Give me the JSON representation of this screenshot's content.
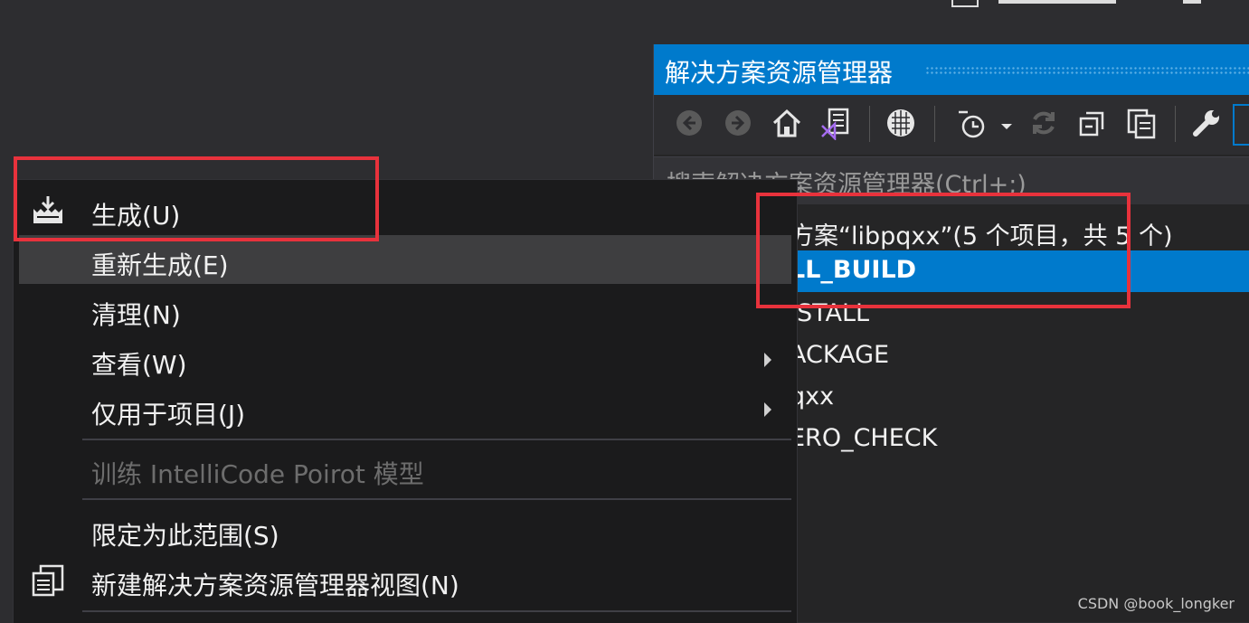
{
  "explorer": {
    "title": "解决方案资源管理器",
    "search_placeholder": "搜索解决方案资源管理器(Ctrl+;)",
    "tree": {
      "solution": "方案“libpqxx”(5 个项目，共 5 个)",
      "items": [
        "LL_BUILD",
        "ISTALL",
        "ACKAGE",
        "qxx",
        "ERO_CHECK"
      ]
    },
    "toolbar_icons": [
      "back-icon",
      "forward-icon",
      "home-icon",
      "vs-solution-icon",
      "filter-icon",
      "history-icon",
      "sync-icon",
      "collapse-all-icon",
      "copy-icon",
      "wrench-icon"
    ]
  },
  "context_menu": {
    "items": [
      {
        "label": "生成(U)",
        "icon": "build-icon"
      },
      {
        "label": "重新生成(E)"
      },
      {
        "label": "清理(N)"
      },
      {
        "label": "查看(W)",
        "submenu": true
      },
      {
        "label": "仅用于项目(J)",
        "submenu": true
      },
      {
        "label": "训练 IntelliCode Poirot 模型",
        "disabled": true
      },
      {
        "label": "限定为此范围(S)"
      },
      {
        "label": "新建解决方案资源管理器视图(N)",
        "icon": "new-view-icon"
      }
    ]
  },
  "watermark": "CSDN @book_longker",
  "colors": {
    "accent": "#007acc",
    "highlight": "#e8323c",
    "menu_bg": "#1b1b1c"
  }
}
